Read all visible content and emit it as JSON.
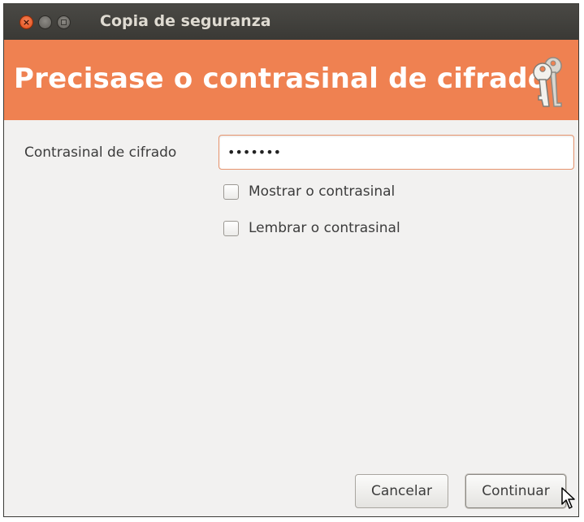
{
  "window": {
    "title": "Copia de seguranza"
  },
  "banner": {
    "title": "Precisase o contrasinal de cifrado",
    "icon": "keys-icon",
    "color": "#ef8151"
  },
  "form": {
    "password_label": "Contrasinal de cifrado",
    "password_value": "•••••••",
    "show_password_label": "Mostrar o contrasinal",
    "show_password_checked": false,
    "remember_password_label": "Lembrar o contrasinal",
    "remember_password_checked": false
  },
  "buttons": {
    "cancel_label": "Cancelar",
    "continue_label": "Continuar"
  }
}
